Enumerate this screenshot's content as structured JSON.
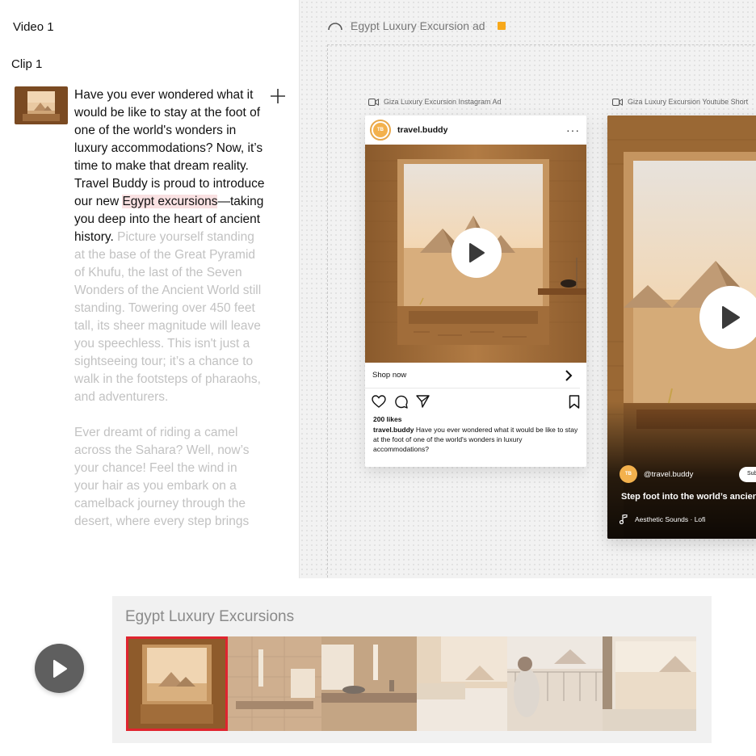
{
  "left_panel": {
    "video_label": "Video 1",
    "clip_label": "Clip 1",
    "script_active_1": "Have you ever wondered what it would be like to stay at the foot of one of the world's wonders in luxury accommodations? Now, it’s time to make that dream reality. Travel Buddy is proud to introduce our new ",
    "script_highlight": "Egypt excursions",
    "script_active_2": "—taking you deep into the heart of ancient history.",
    "script_dim_1": "Picture yourself standing at the base of the Great Pyramid of Khufu, the last of the Seven Wonders of the Ancient World still standing. Towering over 450 feet tall, its sheer magnitude will leave you speechless. This isn't just a sightseeing tour; it’s a chance to walk in the footsteps of pharaohs, and adventurers.",
    "script_dim_2": "Ever dreamt of riding a camel across the Sahara? Well, now’s your chance! Feel the wind in your hair as you embark on a camelback journey through the desert, where every step brings"
  },
  "canvas": {
    "title": "Egypt Luxury Excursion ad",
    "status_color": "#f7a81b",
    "instagram_ad": {
      "label": "Giza Luxury Excursion Instagram Ad",
      "username": "travel.buddy",
      "avatar_text": "TB",
      "more_icon": "···",
      "shop_label": "Shop now",
      "likes": "200 likes",
      "caption_user": "travel.buddy",
      "caption_text": "Have you ever wondered what it would be like to stay at the foot of one of the world's wonders in luxury accommodations?"
    },
    "youtube_ad": {
      "label": "Giza Luxury Excursion Youtube Short",
      "handle": "@travel.buddy",
      "avatar_text": "TB",
      "subscribe_label": "Sub",
      "caption": "Step foot into the world’s ancient",
      "music": "Aesthetic Sounds · Lofi"
    }
  },
  "timeline": {
    "title": "Egypt Luxury Excursions",
    "selected_index": 0,
    "frame_names": [
      "pyramid-window-bath",
      "stone-bathroom",
      "bathroom-sink",
      "bedroom-window",
      "balcony-woman",
      "window-view"
    ],
    "accent": "#e0242f"
  }
}
